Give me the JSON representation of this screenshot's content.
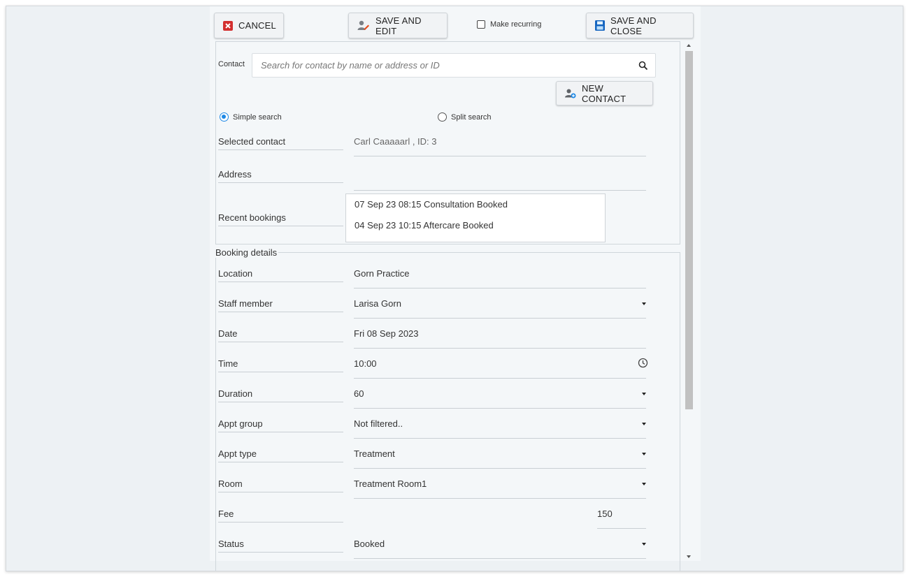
{
  "toolbar": {
    "cancel_label": "CANCEL",
    "save_edit_label": "SAVE AND EDIT",
    "make_recurring_label": "Make recurring",
    "save_close_label": "SAVE AND CLOSE"
  },
  "contact_search": {
    "label": "Contact",
    "placeholder": "Search for contact by name or address or ID",
    "new_contact_label": "NEW CONTACT",
    "simple_search_label": "Simple search",
    "split_search_label": "Split search",
    "selected_mode": "simple"
  },
  "contact_details": {
    "selected_contact_label": "Selected contact",
    "selected_contact_value": "Carl Caaaaarl , ID: 3",
    "address_label": "Address",
    "address_value": "",
    "recent_bookings_label": "Recent bookings",
    "recent_bookings": [
      "07 Sep 23 08:15 Consultation Booked",
      "04 Sep 23 10:15 Aftercare Booked"
    ]
  },
  "booking": {
    "legend": "Booking details",
    "fields": [
      {
        "label": "Location",
        "value": "Gorn Practice"
      },
      {
        "label": "Staff member",
        "value": "Larisa Gorn"
      },
      {
        "label": "Date",
        "value": "Fri 08 Sep 2023"
      },
      {
        "label": "Time",
        "value": "10:00"
      },
      {
        "label": "Duration",
        "value": "60"
      },
      {
        "label": "Appt group",
        "value": "Not filtered.."
      },
      {
        "label": "Appt type",
        "value": "Treatment"
      },
      {
        "label": "Room",
        "value": "Treatment Room1"
      },
      {
        "label": "Fee",
        "value": "150"
      },
      {
        "label": "Status",
        "value": "Booked"
      }
    ]
  },
  "colors": {
    "accent": "#1e88e5",
    "cancel_icon": "#d32f2f",
    "save_icon": "#1565c0",
    "panel_bg": "#f4f7f9",
    "page_bg": "#edf1f4"
  },
  "icons": [
    "cancel-icon",
    "edit-user-icon",
    "save-disk-icon",
    "search-icon",
    "add-contact-icon",
    "clock-icon",
    "dropdown-caret-icon"
  ]
}
